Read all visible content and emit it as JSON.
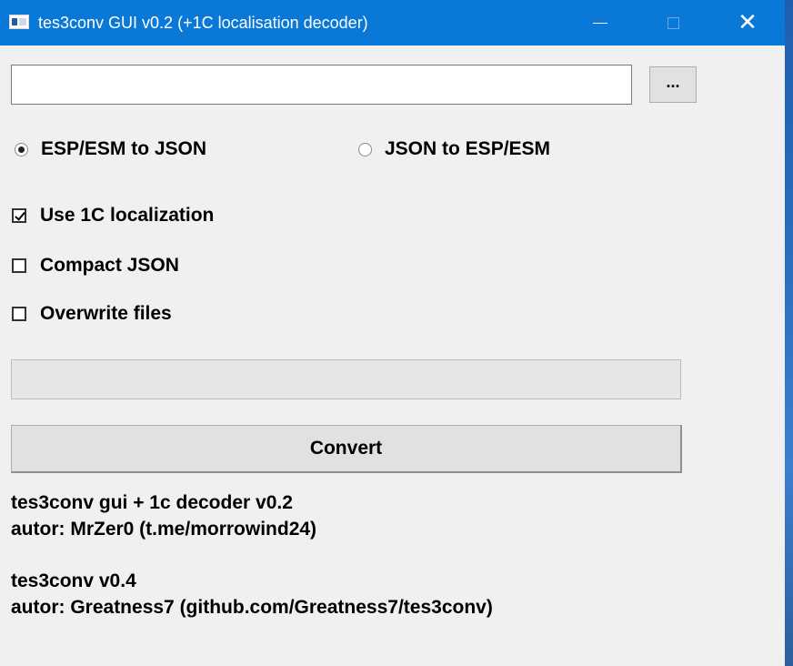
{
  "window": {
    "title": "tes3conv GUI v0.2 (+1C localisation decoder)",
    "icons": {
      "app": "app-icon",
      "minimize": "minimize-icon",
      "maximize": "maximize-icon",
      "close": "close-icon"
    },
    "close_glyph": "✕"
  },
  "file": {
    "path_value": "",
    "browse_label": "..."
  },
  "mode": {
    "options": [
      {
        "label": "ESP/ESM to JSON",
        "selected": true
      },
      {
        "label": "JSON to ESP/ESM",
        "selected": false
      }
    ]
  },
  "settings": {
    "use_1c": {
      "label": "Use 1C localization",
      "checked": true
    },
    "compact_json": {
      "label": "Compact JSON",
      "checked": false
    },
    "overwrite": {
      "label": "Overwrite files",
      "checked": false
    }
  },
  "progress": {
    "value": 0
  },
  "actions": {
    "convert_label": "Convert"
  },
  "info": {
    "gui_version": "tes3conv gui + 1c decoder v0.2",
    "gui_author": "autor: MrZer0 (t.me/morrowind24)",
    "conv_version": "tes3conv v0.4",
    "conv_author": "autor: Greatness7 (github.com/Greatness7/tes3conv)"
  },
  "colors": {
    "titlebar": "#0a78d7",
    "window_bg": "#f0f0f0",
    "progress_fill": "#06b025"
  }
}
